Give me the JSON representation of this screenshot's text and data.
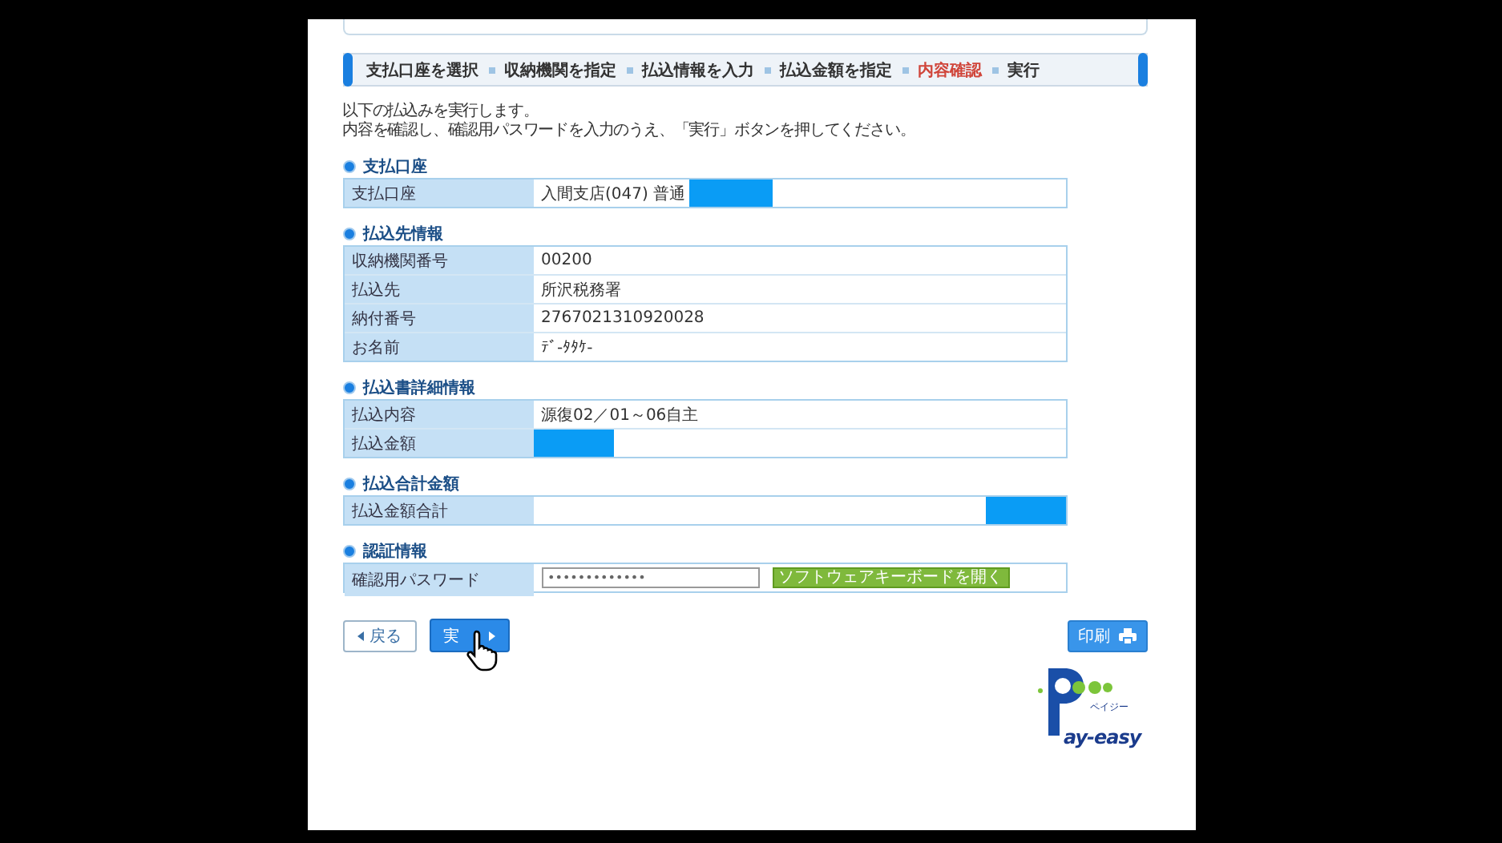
{
  "steps": [
    {
      "label": "支払口座を選択",
      "current": false
    },
    {
      "label": "収納機関を指定",
      "current": false
    },
    {
      "label": "払込情報を入力",
      "current": false
    },
    {
      "label": "払込金額を指定",
      "current": false
    },
    {
      "label": "内容確認",
      "current": true
    },
    {
      "label": "実行",
      "current": false
    }
  ],
  "intro": [
    "以下の払込みを実行します。",
    "内容を確認し、確認用パスワードを入力のうえ、「実行」ボタンを押してください。"
  ],
  "sections": [
    {
      "title": "支払口座",
      "rows": [
        {
          "label": "支払口座",
          "value": "入間支店(047) 普通",
          "redacted": true
        }
      ]
    },
    {
      "title": "払込先情報",
      "rows": [
        {
          "label": "収納機関番号",
          "value": "00200"
        },
        {
          "label": "払込先",
          "value": "所沢税務署"
        },
        {
          "label": "納付番号",
          "value": "2767021310920028"
        },
        {
          "label": "お名前",
          "value": "ﾃﾞ-ﾀﾀｹ-"
        }
      ]
    },
    {
      "title": "払込書詳細情報",
      "rows": [
        {
          "label": "払込内容",
          "value": "源復02／01～06自主"
        },
        {
          "label": "払込金額",
          "redacted": true
        }
      ]
    },
    {
      "title": "払込合計金額",
      "rows": [
        {
          "label": "払込金額合計",
          "redacted": true
        }
      ],
      "total": true
    },
    {
      "title": "認証情報",
      "password": {
        "label": "確認用パスワード",
        "value": "•••••••••••••",
        "keyboard_button": "ソフトウェアキーボードを開く"
      }
    }
  ],
  "buttons": {
    "back": "戻る",
    "execute": "実",
    "print": "印刷"
  },
  "logo": {
    "text": "ay-easy",
    "kana": "ペイジー"
  }
}
